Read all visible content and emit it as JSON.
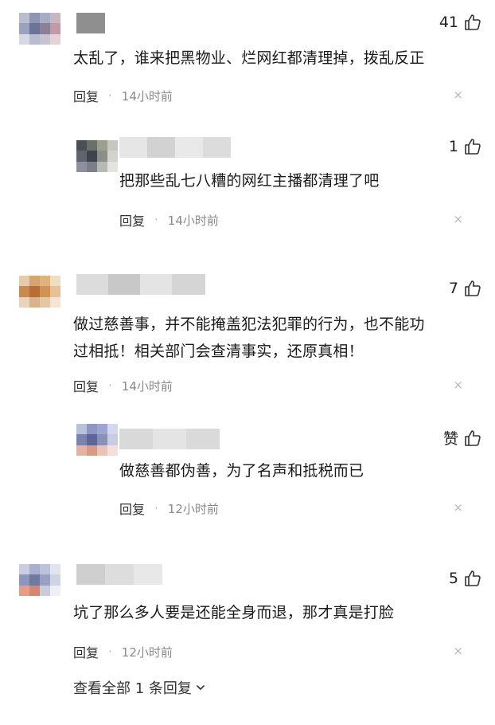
{
  "comments": [
    {
      "likes": "41",
      "text": "太乱了，谁来把黑物业、烂网红都清理掉，拨乱反正",
      "reply_label": "回复",
      "time": "14小时前",
      "close": "×"
    },
    {
      "likes": "1",
      "text": "把那些乱七八糟的网红主播都清理了吧",
      "reply_label": "回复",
      "time": "14小时前",
      "close": "×"
    },
    {
      "likes": "7",
      "text_line1": "做过慈善事，并不能掩盖犯法犯罪的行为，也不能功",
      "text_line2": "过相抵！相关部门会查清事实，还原真相！",
      "reply_label": "回复",
      "time": "14小时前",
      "close": "×"
    },
    {
      "likes": "赞",
      "text": "做慈善都伪善，为了名声和抵税而已",
      "reply_label": "回复",
      "time": "12小时前",
      "close": "×"
    },
    {
      "likes": "5",
      "text": "坑了那么多人要是还能全身而退，那才真是打脸",
      "reply_label": "回复",
      "time": "12小时前",
      "close": "×"
    }
  ],
  "separator": "·",
  "view_all": "查看全部 1 条回复",
  "colors": {
    "text": "#1a1a1a",
    "meta": "#8a8a8a",
    "close": "#b8b8b8"
  }
}
